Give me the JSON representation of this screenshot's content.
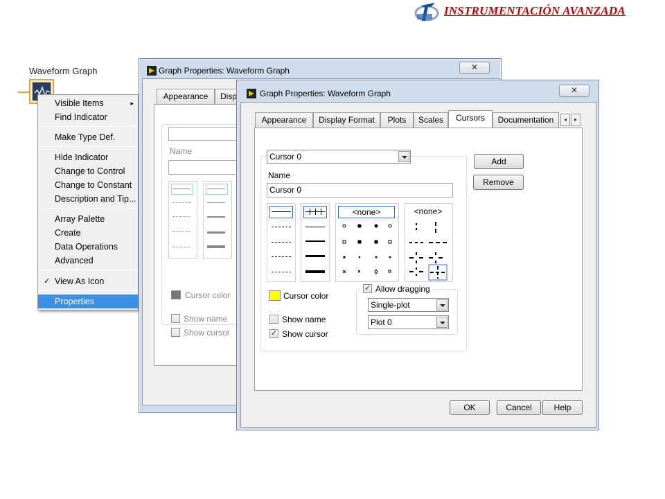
{
  "header": {
    "brand_text": "INSTRUMENTACIÓN AVANZADA",
    "brand_color": "#c00000"
  },
  "front_panel": {
    "control_label": "Waveform Graph"
  },
  "context_menu": {
    "items": [
      {
        "label": "Visible Items"
      },
      {
        "label": "Find Indicator"
      },
      {
        "label": "Make Type Def."
      },
      {
        "label": "Hide Indicator"
      },
      {
        "label": "Change to Control"
      },
      {
        "label": "Change to Constant"
      },
      {
        "label": "Description and Tip..."
      },
      {
        "label": "Array Palette"
      },
      {
        "label": "Create"
      },
      {
        "label": "Data Operations"
      },
      {
        "label": "Advanced"
      },
      {
        "label": "View As Icon",
        "checked": true
      },
      {
        "label": "Properties",
        "selected": true
      }
    ],
    "check_glyph": "✓",
    "selected_color": "#3d8ee6"
  },
  "back_dialog": {
    "title": "Graph Properties: Waveform Graph",
    "close_glyph": "✕",
    "tabs": [
      "Appearance",
      "Disp"
    ],
    "name_label": "Name",
    "cursor_color_label": "Cursor color",
    "show_name_label": "Show name",
    "show_cursor_label": "Show cursor"
  },
  "front_dialog": {
    "title": "Graph Properties: Waveform Graph",
    "close_glyph": "✕",
    "tabs": [
      {
        "label": "Appearance"
      },
      {
        "label": "Display Format"
      },
      {
        "label": "Plots"
      },
      {
        "label": "Scales"
      },
      {
        "label": "Cursors",
        "active": true
      },
      {
        "label": "Documentation"
      }
    ],
    "tab_scroll_left": "◂",
    "tab_scroll_right": "▸",
    "cursors": {
      "cursor_select_value": "Cursor 0",
      "name_label": "Name",
      "name_value": "Cursor 0",
      "add_label": "Add",
      "remove_label": "Remove",
      "point_style_value": "<none>",
      "cursor_style_value": "<none>",
      "cursor_color_label": "Cursor color",
      "cursor_color": "#ffff00",
      "show_name_label": "Show name",
      "show_name_checked": false,
      "show_cursor_label": "Show cursor",
      "show_cursor_checked": true,
      "allow_dragging_label": "Allow dragging",
      "allow_dragging_checked": true,
      "drag_mode_value": "Single-plot",
      "plot_value": "Plot 0",
      "check_glyph": "✓"
    },
    "footer": {
      "ok_label": "OK",
      "cancel_label": "Cancel",
      "help_label": "Help"
    }
  }
}
